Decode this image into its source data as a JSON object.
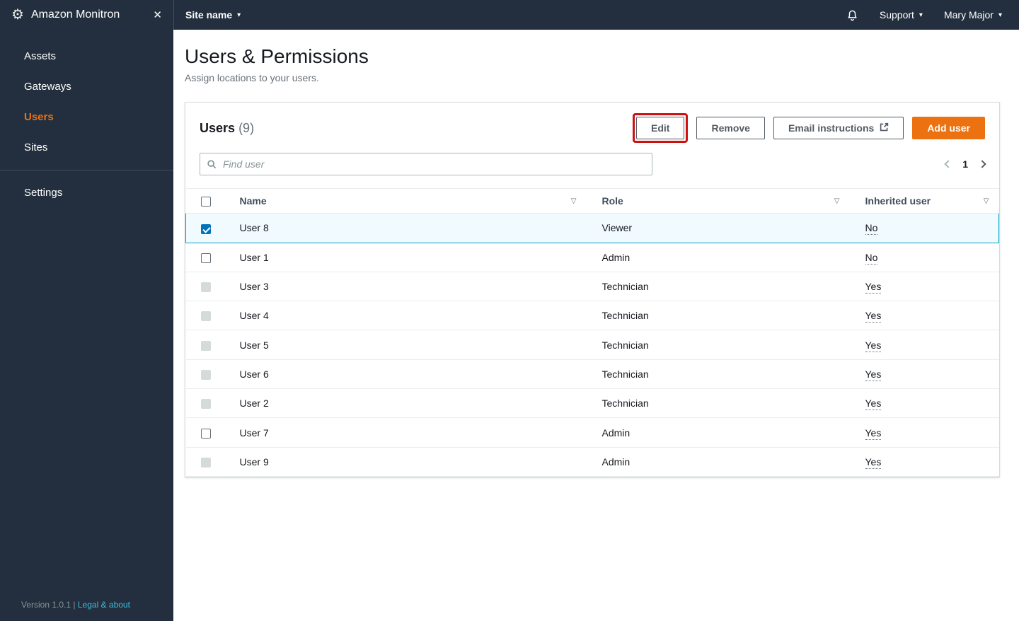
{
  "topbar": {
    "site_name": "Site name",
    "support": "Support",
    "user": "Mary Major"
  },
  "sidebar": {
    "app_name": "Amazon Monitron",
    "items": [
      {
        "label": "Assets"
      },
      {
        "label": "Gateways"
      },
      {
        "label": "Users"
      },
      {
        "label": "Sites"
      }
    ],
    "settings_label": "Settings",
    "footer": {
      "version": "Version 1.0.1",
      "separator": "|",
      "legal_link": "Legal & about"
    }
  },
  "main": {
    "title": "Users & Permissions",
    "subtitle": "Assign locations to your users.",
    "panel": {
      "heading": "Users",
      "count": "(9)",
      "buttons": {
        "edit": "Edit",
        "remove": "Remove",
        "email": "Email instructions",
        "add": "Add user"
      },
      "search_placeholder": "Find user",
      "pagination": {
        "current": "1"
      },
      "table": {
        "columns": [
          "Name",
          "Role",
          "Inherited user"
        ],
        "rows": [
          {
            "name": "User 8",
            "role": "Viewer",
            "inherited": "No",
            "checkbox": "checked",
            "selected": true
          },
          {
            "name": "User 1",
            "role": "Admin",
            "inherited": "No",
            "checkbox": "unchecked",
            "selected": false
          },
          {
            "name": "User 3",
            "role": "Technician",
            "inherited": "Yes",
            "checkbox": "disabled",
            "selected": false
          },
          {
            "name": "User 4",
            "role": "Technician",
            "inherited": "Yes",
            "checkbox": "disabled",
            "selected": false
          },
          {
            "name": "User 5",
            "role": "Technician",
            "inherited": "Yes",
            "checkbox": "disabled",
            "selected": false
          },
          {
            "name": "User 6",
            "role": "Technician",
            "inherited": "Yes",
            "checkbox": "disabled",
            "selected": false
          },
          {
            "name": "User 2",
            "role": "Technician",
            "inherited": "Yes",
            "checkbox": "disabled",
            "selected": false
          },
          {
            "name": "User 7",
            "role": "Admin",
            "inherited": "Yes",
            "checkbox": "unchecked",
            "selected": false
          },
          {
            "name": "User 9",
            "role": "Admin",
            "inherited": "Yes",
            "checkbox": "disabled",
            "selected": false
          }
        ]
      }
    }
  },
  "colors": {
    "nav_background": "#232f3e",
    "accent_orange": "#ec7211",
    "selected_row_border": "#00a1c9",
    "selected_row_background": "#f1faff",
    "annotation_red": "#cc1111"
  }
}
